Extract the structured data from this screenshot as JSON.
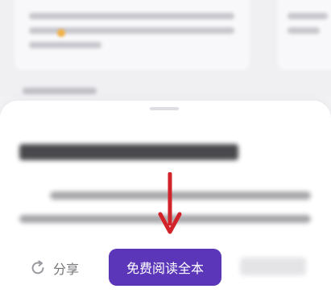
{
  "actions": {
    "share_label": "分享",
    "read_label": "免费阅读全本"
  },
  "icons": {
    "share": "share-refresh-icon",
    "arrow": "down-arrow-icon"
  },
  "colors": {
    "primary": "#5b36b8",
    "arrow": "#d2232a",
    "share_text": "#757579"
  }
}
